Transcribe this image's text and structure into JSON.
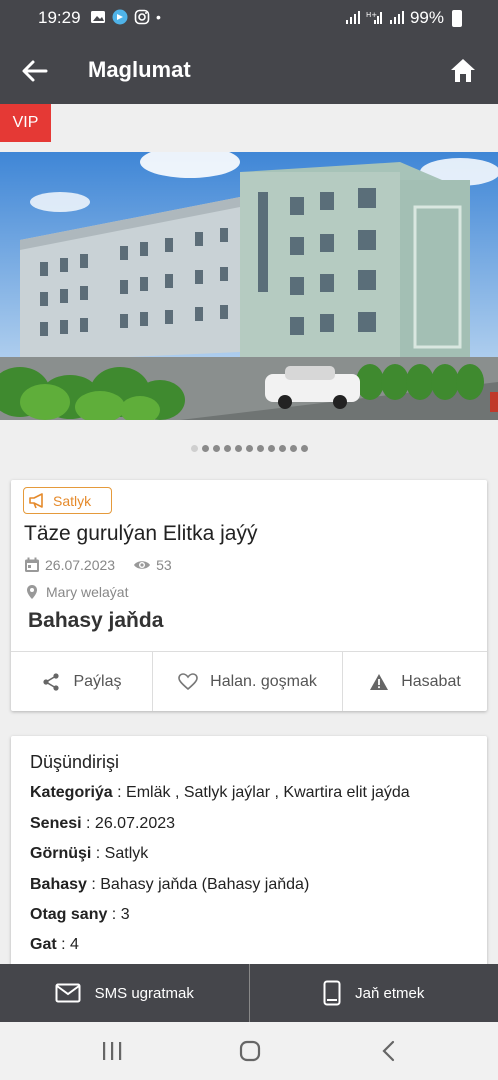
{
  "status": {
    "time": "19:29",
    "battery": "99%"
  },
  "appbar": {
    "title": "Maglumat"
  },
  "vip": "VIP",
  "gallery": {
    "count": 11,
    "active": 0
  },
  "listing": {
    "badge": "Satlyk",
    "title": "Täze gurulýan Elitka jaýý",
    "date": "26.07.2023",
    "views": "53",
    "location": "Mary welaýat",
    "price": "Bahasy jaňda"
  },
  "actions": {
    "share": "Paýlaş",
    "favorite": "Halan. goşmak",
    "report": "Hasabat"
  },
  "description": {
    "title": "Düşündirişi",
    "rows": [
      {
        "key": "Kategoriýa",
        "value": " : Emläk , Satlyk jaýlar , Kwartira elit jaýda"
      },
      {
        "key": "Senesi",
        "value": " : 26.07.2023"
      },
      {
        "key": "Görnüşi",
        "value": " : Satlyk"
      },
      {
        "key": "Bahasy",
        "value": " : Bahasy jaňda (Bahasy jaňda)"
      },
      {
        "key": "Otag sany",
        "value": " : 3"
      },
      {
        "key": "Gat",
        "value": " : 4"
      }
    ]
  },
  "bottom": {
    "sms": "SMS ugratmak",
    "call": "Jaň etmek"
  },
  "colors": {
    "bar": "#45464b",
    "vip": "#e53935",
    "badge": "#e59a3b"
  }
}
